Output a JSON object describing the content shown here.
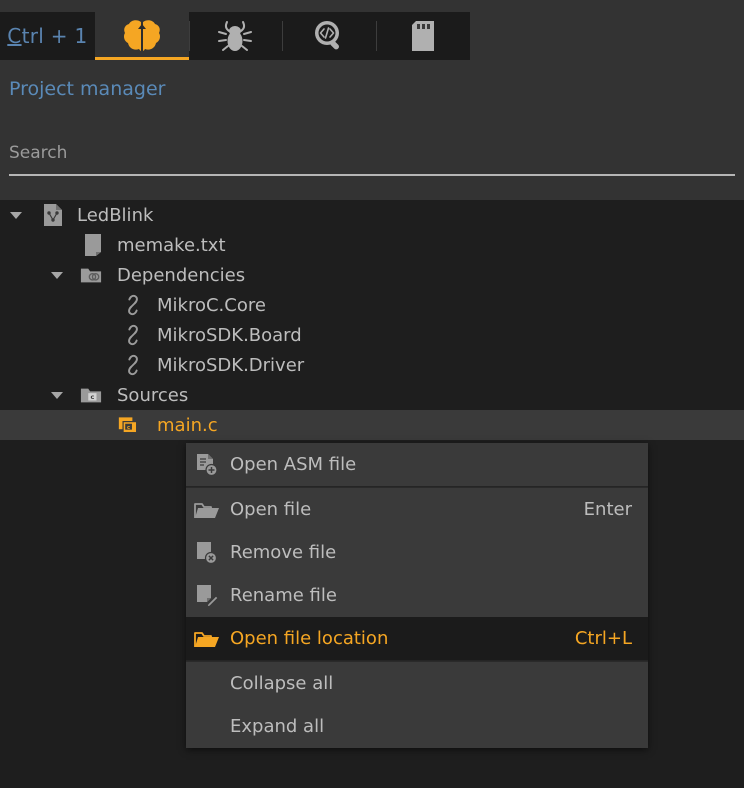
{
  "toolbar": {
    "shortcut_label": "Ctrl + 1",
    "shortcut_underlined": "C",
    "shortcut_rest": "trl + 1",
    "tabs": [
      {
        "name": "project-manager",
        "icon": "brain-icon",
        "active": true
      },
      {
        "name": "debugger",
        "icon": "bug-icon",
        "active": false
      },
      {
        "name": "code-explorer",
        "icon": "code-search-icon",
        "active": false
      },
      {
        "name": "memory",
        "icon": "memory-card-icon",
        "active": false
      }
    ]
  },
  "panel": {
    "title": "Project manager",
    "search": {
      "value": "",
      "placeholder": "Search"
    }
  },
  "tree": {
    "nodes": [
      {
        "label": "LedBlink",
        "icon": "project-file-icon",
        "depth": 0,
        "twisty": "expanded",
        "selected": false,
        "accent": false
      },
      {
        "label": "memake.txt",
        "icon": "text-file-icon",
        "depth": 1,
        "twisty": "none",
        "selected": false,
        "accent": false
      },
      {
        "label": "Dependencies",
        "icon": "folder-deps-icon",
        "depth": 1,
        "twisty": "expanded",
        "selected": false,
        "accent": false
      },
      {
        "label": "MikroC.Core",
        "icon": "link-icon",
        "depth": 2,
        "twisty": "none",
        "selected": false,
        "accent": false
      },
      {
        "label": "MikroSDK.Board",
        "icon": "link-icon",
        "depth": 2,
        "twisty": "none",
        "selected": false,
        "accent": false
      },
      {
        "label": "MikroSDK.Driver",
        "icon": "link-icon",
        "depth": 2,
        "twisty": "none",
        "selected": false,
        "accent": false
      },
      {
        "label": "Sources",
        "icon": "folder-c-icon",
        "depth": 1,
        "twisty": "expanded",
        "selected": false,
        "accent": false
      },
      {
        "label": "main.c",
        "icon": "c-file-icon",
        "depth": 2,
        "twisty": "none",
        "selected": true,
        "accent": true
      }
    ]
  },
  "context_menu": {
    "items": [
      {
        "type": "item",
        "label": "Open ASM file",
        "shortcut": "",
        "icon": "asm-file-icon",
        "highlight": false
      },
      {
        "type": "separator"
      },
      {
        "type": "item",
        "label": "Open file",
        "shortcut": "Enter",
        "icon": "open-folder-icon",
        "highlight": false
      },
      {
        "type": "item",
        "label": "Remove file",
        "shortcut": "",
        "icon": "remove-file-icon",
        "highlight": false
      },
      {
        "type": "item",
        "label": "Rename file",
        "shortcut": "",
        "icon": "rename-file-icon",
        "highlight": false
      },
      {
        "type": "item",
        "label": "Open file location",
        "shortcut": "Ctrl+L",
        "icon": "open-folder-icon",
        "highlight": true
      },
      {
        "type": "separator"
      },
      {
        "type": "item",
        "label": "Collapse all",
        "shortcut": "",
        "icon": "none",
        "highlight": false
      },
      {
        "type": "item",
        "label": "Expand all",
        "shortcut": "",
        "icon": "none",
        "highlight": false
      }
    ]
  },
  "colors": {
    "accent": "#f5a623",
    "toolbar_bg": "#333333",
    "panel_bg": "#333333",
    "tree_bg": "#1e1e1e",
    "menu_bg": "#3a3a3a",
    "menu_highlight_bg": "#1b1b1b",
    "text": "#bdbdbd",
    "title_blue": "#5a8ab8",
    "selection_bg": "#3a3a3a"
  }
}
